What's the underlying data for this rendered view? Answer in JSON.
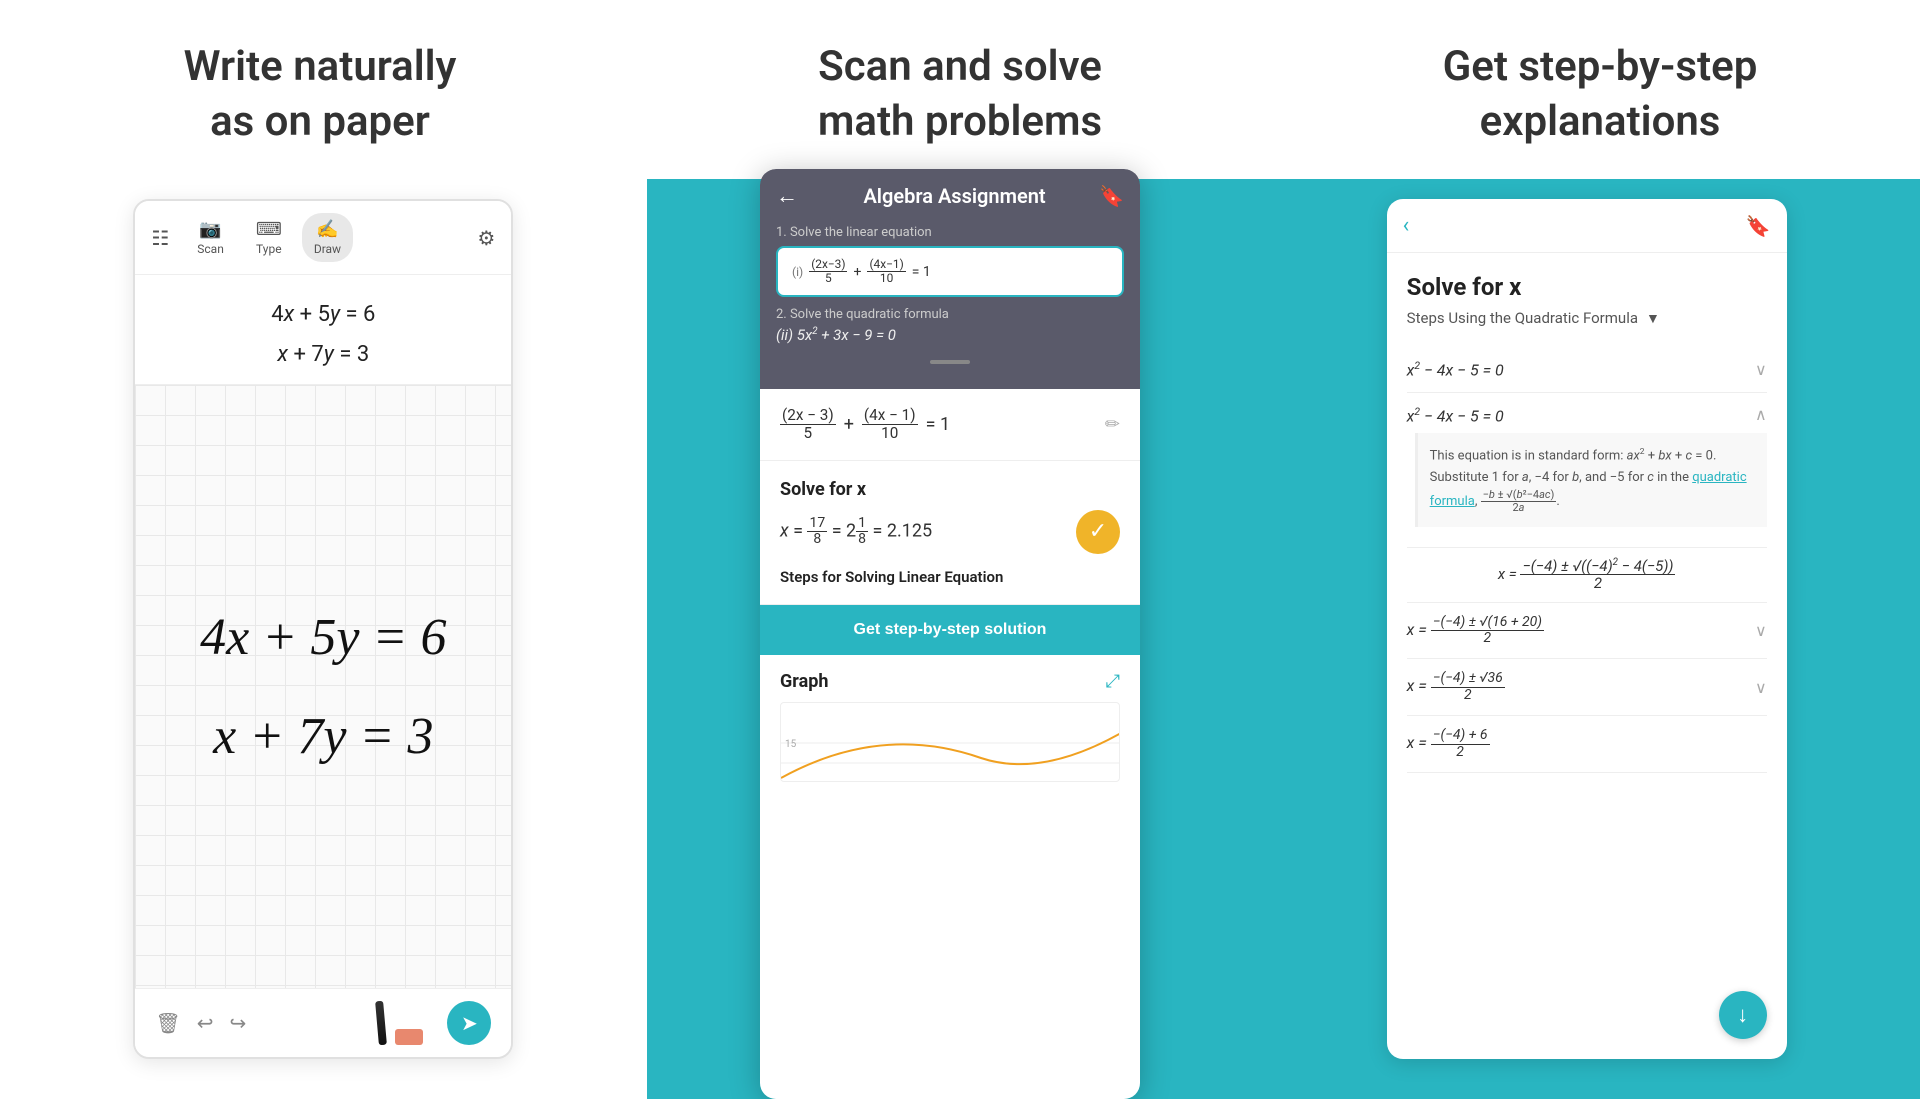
{
  "header": {
    "col1_line1": "Write naturally",
    "col1_line2": "as on paper",
    "col2_line1": "Scan and solve",
    "col2_line2": "math problems",
    "col3_line1": "Get step-by-step",
    "col3_line2": "explanations"
  },
  "left_panel": {
    "toolbar": {
      "scan_label": "Scan",
      "type_label": "Type",
      "draw_label": "Draw"
    },
    "formula1": "4x + 5y = 6",
    "formula2": "x + 7y = 3",
    "handwritten1": "4x + 5y = 6",
    "handwritten2": "x + 7y = 3",
    "bottom_icons": {
      "trash": "🗑",
      "undo": "↩",
      "redo": "↪"
    }
  },
  "middle_panel": {
    "title": "Algebra Assignment",
    "problem1_label": "1. Solve the linear equation",
    "problem1_number": "(i)",
    "problem1_formula": "(2x−3)/5 + (4x−1)/10 = 1",
    "problem2_label": "2. Solve the quadratic formula",
    "problem2_formula": "(ii) 5x² + 3x − 9 = 0",
    "card_formula": "(2x − 3)/5 + (4x − 1)/10 = 1",
    "solve_title": "Solve for x",
    "solve_result": "x = 17/8 = 2 1/8 = 2.125",
    "steps_label": "Steps for Solving Linear Equation",
    "step_btn_label": "Get step-by-step solution",
    "graph_title": "Graph",
    "graph_expand": "⤢"
  },
  "right_panel": {
    "title": "Solve for x",
    "subtitle": "Steps Using the Quadratic Formula",
    "step1": "x² − 4x − 5 = 0",
    "step2": "x² − 4x − 5 = 0",
    "explanation": "This equation is in standard form: ax² + bx + c = 0. Substitute 1 for a, −4 for b, and −5 for c in the quadratic formula, (−b ± √(b²−4ac)) / 2a.",
    "step3": "x = (−(−4) ± √((−4)² − 4(−5))) / 2",
    "step4": "x = (−(−4) ± √(16 + 20)) / 2",
    "step5": "x = (−(−4) ± √36) / 2",
    "step6": "x = (−(−4) + 6) / 2",
    "quadratic_link": "quadratic formula"
  },
  "icons": {
    "scan": "📷",
    "type": "⌨",
    "draw": "✍",
    "gear": "⚙",
    "back": "←",
    "bookmark": "🔖",
    "edit": "✏",
    "check": "✓",
    "chevron_down": "∨",
    "chevron_up": "∧",
    "chevron_left": "‹",
    "arrow_down": "↓",
    "expand": "⤢",
    "send": "➤",
    "trash": "🗑",
    "undo": "↩",
    "redo": "↪"
  },
  "colors": {
    "teal": "#29b5c1",
    "dark_text": "#333333",
    "light_gray": "#f0f0f0",
    "yellow": "#f0b429"
  }
}
